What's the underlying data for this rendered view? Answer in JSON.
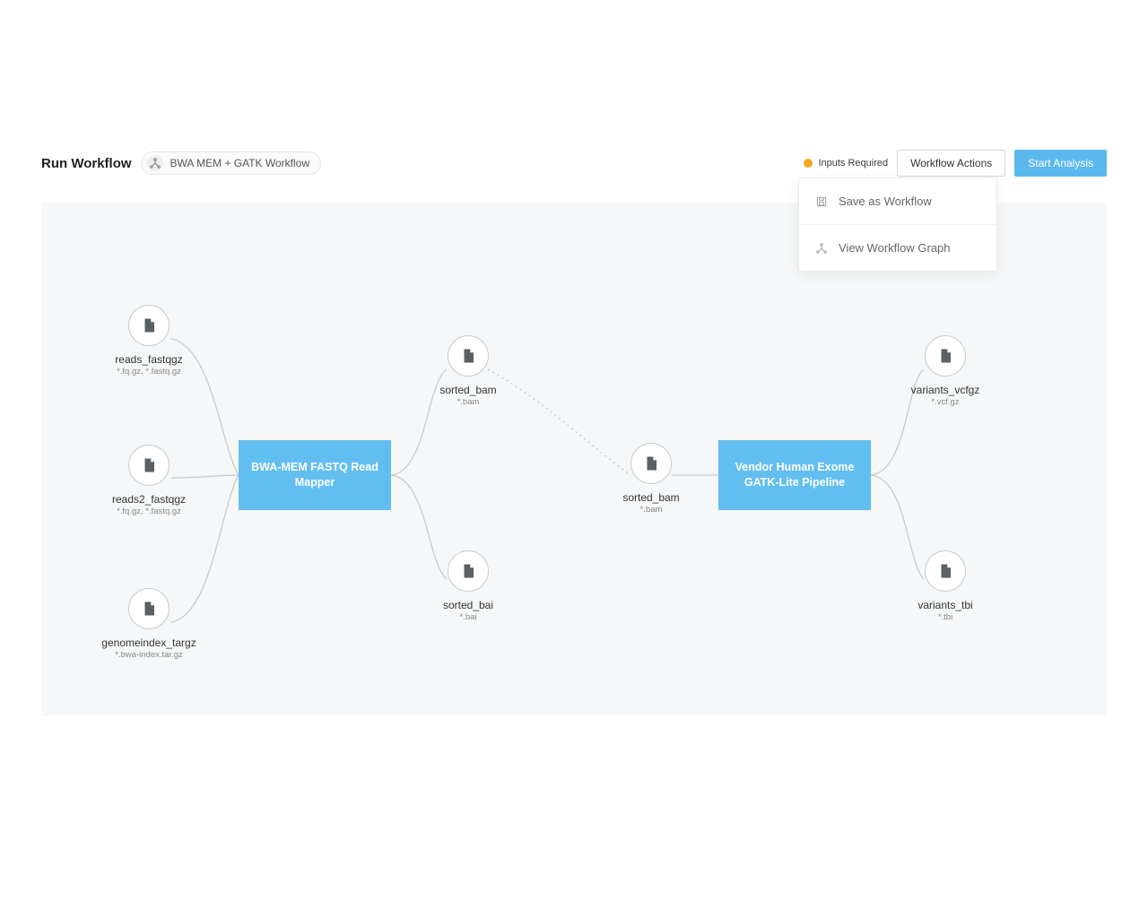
{
  "header": {
    "page_title": "Run Workflow",
    "workflow_name": "BWA MEM + GATK Workflow",
    "inputs_required_label": "Inputs Required",
    "actions_button": "Workflow Actions",
    "start_button": "Start Analysis"
  },
  "dropdown": {
    "save_label": "Save as Workflow",
    "view_graph_label": "View Workflow Graph"
  },
  "nodes": {
    "reads_fastqgz": {
      "name": "reads_fastqgz",
      "ext": "*.fq.gz, *.fastq.gz"
    },
    "reads2_fastqgz": {
      "name": "reads2_fastqgz",
      "ext": "*.fq.gz, *.fastq.gz"
    },
    "genomeindex": {
      "name": "genomeindex_targz",
      "ext": "*.bwa-index.tar.gz"
    },
    "sorted_bam_1": {
      "name": "sorted_bam",
      "ext": "*.bam"
    },
    "sorted_bai": {
      "name": "sorted_bai",
      "ext": "*.bai"
    },
    "sorted_bam_2": {
      "name": "sorted_bam",
      "ext": "*.bam"
    },
    "variants_vcfgz": {
      "name": "variants_vcfgz",
      "ext": "*.vcf.gz"
    },
    "variants_tbi": {
      "name": "variants_tbi",
      "ext": "*.tbi"
    }
  },
  "stages": {
    "bwa": "BWA-MEM FASTQ Read Mapper",
    "gatk": "Vendor Human Exome GATK-Lite Pipeline"
  },
  "chart_data": {
    "type": "dag",
    "nodes": [
      {
        "id": "reads_fastqgz",
        "kind": "file",
        "label": "reads_fastqgz",
        "ext": "*.fq.gz, *.fastq.gz"
      },
      {
        "id": "reads2_fastqgz",
        "kind": "file",
        "label": "reads2_fastqgz",
        "ext": "*.fq.gz, *.fastq.gz"
      },
      {
        "id": "genomeindex",
        "kind": "file",
        "label": "genomeindex_targz",
        "ext": "*.bwa-index.tar.gz"
      },
      {
        "id": "bwa",
        "kind": "stage",
        "label": "BWA-MEM FASTQ Read Mapper"
      },
      {
        "id": "sorted_bam_1",
        "kind": "file",
        "label": "sorted_bam",
        "ext": "*.bam"
      },
      {
        "id": "sorted_bai",
        "kind": "file",
        "label": "sorted_bai",
        "ext": "*.bai"
      },
      {
        "id": "sorted_bam_2",
        "kind": "file",
        "label": "sorted_bam",
        "ext": "*.bam"
      },
      {
        "id": "gatk",
        "kind": "stage",
        "label": "Vendor Human Exome GATK-Lite Pipeline"
      },
      {
        "id": "variants_vcfgz",
        "kind": "file",
        "label": "variants_vcfgz",
        "ext": "*.vcf.gz"
      },
      {
        "id": "variants_tbi",
        "kind": "file",
        "label": "variants_tbi",
        "ext": "*.tbi"
      }
    ],
    "edges": [
      {
        "from": "reads_fastqgz",
        "to": "bwa",
        "style": "solid"
      },
      {
        "from": "reads2_fastqgz",
        "to": "bwa",
        "style": "solid"
      },
      {
        "from": "genomeindex",
        "to": "bwa",
        "style": "solid"
      },
      {
        "from": "bwa",
        "to": "sorted_bam_1",
        "style": "solid"
      },
      {
        "from": "bwa",
        "to": "sorted_bai",
        "style": "solid"
      },
      {
        "from": "sorted_bam_1",
        "to": "sorted_bam_2",
        "style": "dotted"
      },
      {
        "from": "sorted_bam_2",
        "to": "gatk",
        "style": "solid"
      },
      {
        "from": "gatk",
        "to": "variants_vcfgz",
        "style": "solid"
      },
      {
        "from": "gatk",
        "to": "variants_tbi",
        "style": "solid"
      }
    ]
  },
  "colors": {
    "accent": "#62bef0",
    "warn": "#f5a623"
  }
}
